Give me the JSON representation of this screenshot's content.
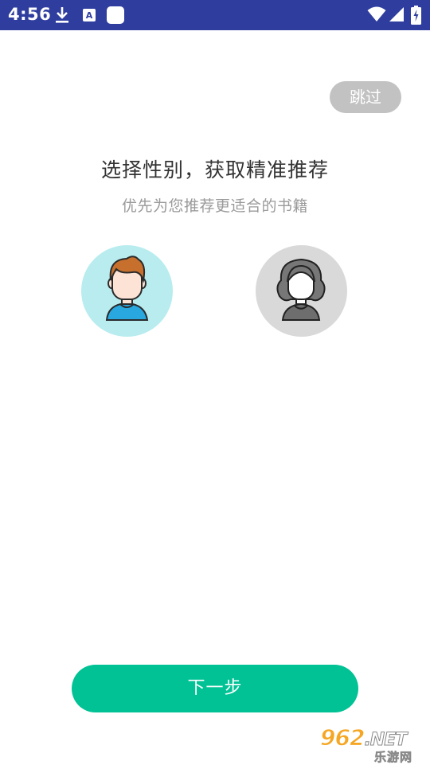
{
  "status_bar": {
    "time": "4:56",
    "icons": [
      "download-icon",
      "accessibility-a-icon",
      "app-placeholder-icon",
      "wifi-icon",
      "cell-signal-icon",
      "battery-charging-icon"
    ],
    "bg_color": "#2f3e9e"
  },
  "skip_label": "跳过",
  "title": "选择性别，获取精准推荐",
  "subtitle": "优先为您推荐更适合的书籍",
  "gender_options": [
    {
      "name": "male-avatar",
      "bg_color": "#b8ecef"
    },
    {
      "name": "female-avatar",
      "bg_color": "#d9d9d9"
    }
  ],
  "next_label": "下一步",
  "watermark": {
    "main": "962",
    "suffix": ".NET",
    "sub": "乐游网"
  },
  "colors": {
    "accent": "#00c295",
    "skip_bg": "#c2c2c2",
    "title": "#333333",
    "subtitle": "#9a9a9a"
  }
}
